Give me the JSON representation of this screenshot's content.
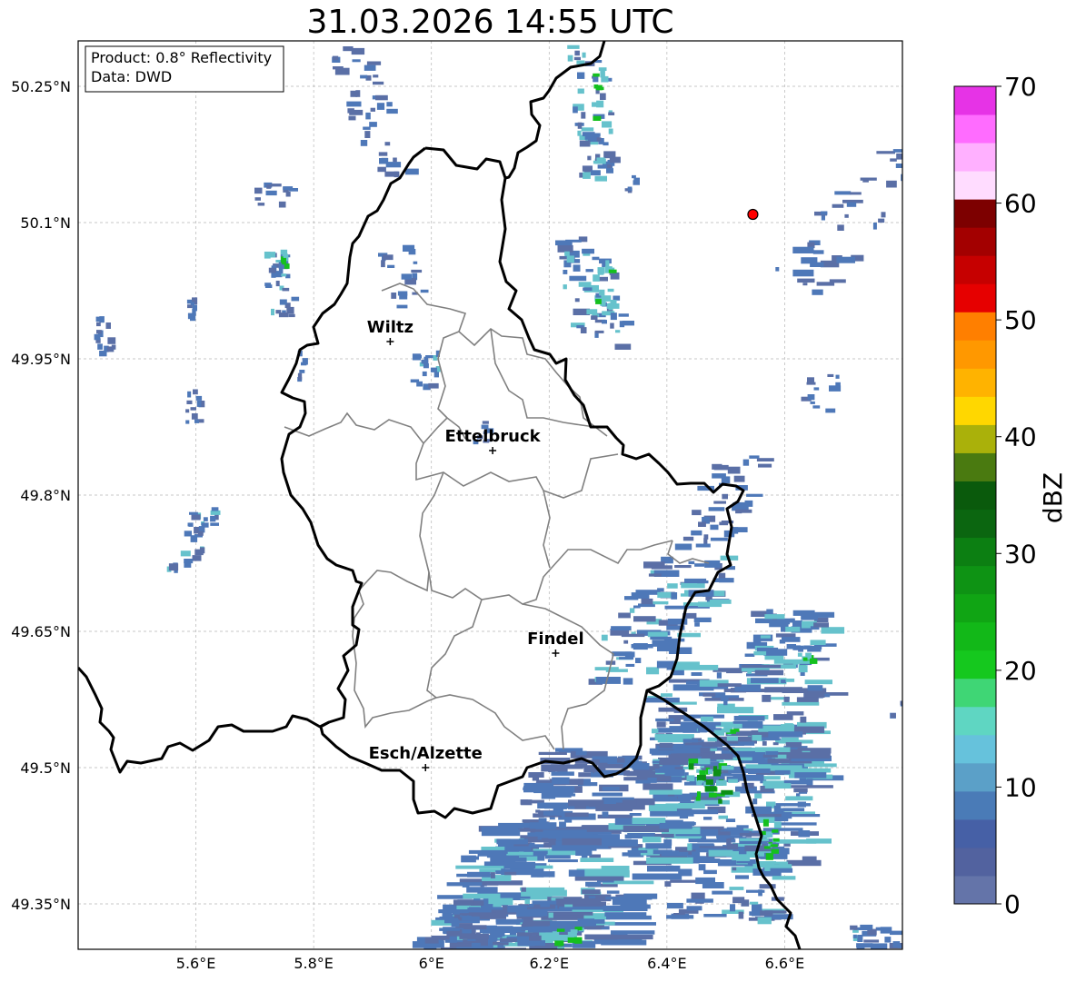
{
  "title": "31.03.2026 14:55 UTC",
  "info_box": {
    "product": "Product: 0.8° Reflectivity",
    "source": "Data: DWD"
  },
  "map": {
    "lon_range": [
      5.4,
      6.8
    ],
    "lat_range": [
      49.3,
      50.3
    ],
    "lon_ticks": [
      {
        "value": 5.6,
        "label": "5.6°E"
      },
      {
        "value": 5.8,
        "label": "5.8°E"
      },
      {
        "value": 6.0,
        "label": "6°E"
      },
      {
        "value": 6.2,
        "label": "6.2°E"
      },
      {
        "value": 6.4,
        "label": "6.4°E"
      },
      {
        "value": 6.6,
        "label": "6.6°E"
      }
    ],
    "lat_ticks": [
      {
        "value": 50.25,
        "label": "50.25°N"
      },
      {
        "value": 50.1,
        "label": "50.1°N"
      },
      {
        "value": 49.95,
        "label": "49.95°N"
      },
      {
        "value": 49.8,
        "label": "49.8°N"
      },
      {
        "value": 49.65,
        "label": "49.65°N"
      },
      {
        "value": 49.5,
        "label": "49.5°N"
      },
      {
        "value": 49.35,
        "label": "49.35°N"
      }
    ],
    "cities": [
      {
        "name": "Wiltz",
        "lon": 5.93,
        "lat": 49.969
      },
      {
        "name": "Ettelbruck",
        "lon": 6.104,
        "lat": 49.849
      },
      {
        "name": "Findel",
        "lon": 6.211,
        "lat": 49.626
      },
      {
        "name": "Esch/Alzette",
        "lon": 5.99,
        "lat": 49.5
      }
    ],
    "marker": {
      "lon": 6.546,
      "lat": 50.109,
      "color": "#ff0000"
    },
    "echo_colors": {
      "light": "#5a6fa6",
      "mid": "#4e78b8",
      "cyan": "#66c2cc",
      "green": "#15c01e",
      "dark_green": "#0d8f16"
    }
  },
  "colorbar": {
    "label": "dBZ",
    "min": 0,
    "max": 70,
    "ticks": [
      {
        "value": 0,
        "label": "0"
      },
      {
        "value": 10,
        "label": "10"
      },
      {
        "value": 20,
        "label": "20"
      },
      {
        "value": 30,
        "label": "30"
      },
      {
        "value": 40,
        "label": "40"
      },
      {
        "value": 50,
        "label": "50"
      },
      {
        "value": 60,
        "label": "60"
      },
      {
        "value": 70,
        "label": "70"
      }
    ],
    "colors": [
      "#6474a9",
      "#52629f",
      "#4660a6",
      "#4a7bb7",
      "#5ba0c8",
      "#66c2dc",
      "#5fd6c2",
      "#3fd675",
      "#15c81e",
      "#12b818",
      "#10a514",
      "#0e9314",
      "#0c7f12",
      "#0b6610",
      "#0a5a0c",
      "#4a7a10",
      "#aab10a",
      "#ffd700",
      "#ffb300",
      "#ff9800",
      "#ff7f00",
      "#e60000",
      "#c60000",
      "#a30000",
      "#7d0000",
      "#ffdcff",
      "#ffb0ff",
      "#ff6cff",
      "#e633e6"
    ]
  }
}
